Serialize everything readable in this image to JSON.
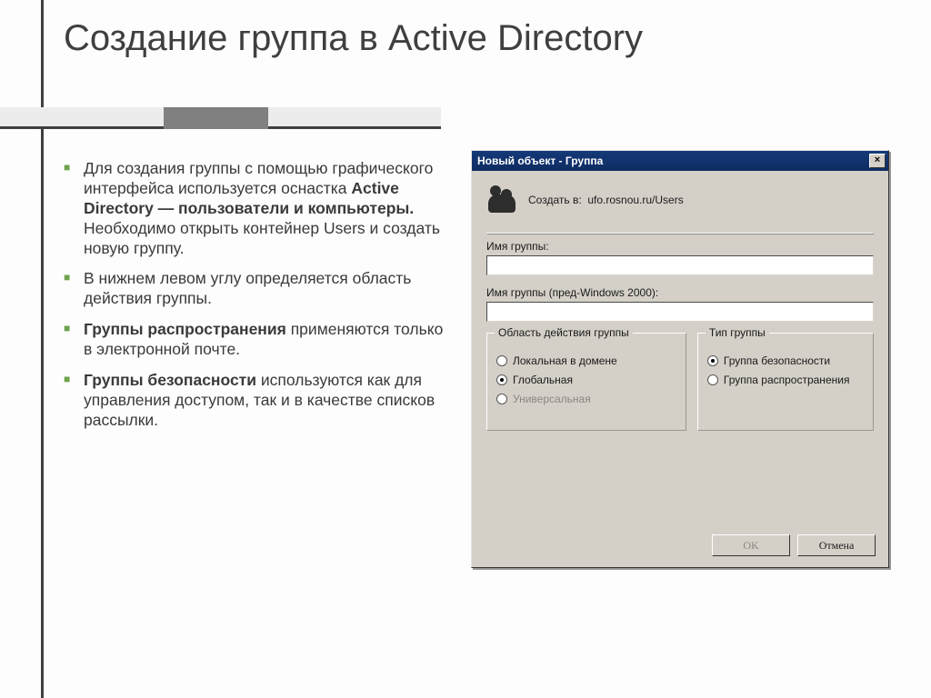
{
  "slide": {
    "title": "Создание группа в Active Directory",
    "bullets": [
      {
        "pre": "Для создания группы с помощью графического интерфейса используется оснастка ",
        "bold": "Active Directory — пользователи и компьютеры.",
        "post": " Необходимо открыть контейнер Users и создать новую группу."
      },
      {
        "text": "В нижнем левом углу определяется область действия группы."
      },
      {
        "bold_first": "Группы распространения",
        "post": " применяются только в электронной почте."
      },
      {
        "bold_first": "Группы безопасности",
        "post": " используются как для управления доступом, так и в качестве списков рассылки."
      }
    ]
  },
  "dialog": {
    "title": "Новый объект - Группа",
    "close_x": "×",
    "create_in_label": "Создать в:",
    "create_in_value": "ufo.rosnou.ru/Users",
    "field1_label": "Имя группы:",
    "field1_value": "",
    "field2_label": "Имя группы (пред-Windows 2000):",
    "field2_value": "",
    "scope": {
      "legend": "Область действия группы",
      "opts": [
        {
          "label": "Локальная в домене",
          "checked": false,
          "disabled": false
        },
        {
          "label": "Глобальная",
          "checked": true,
          "disabled": false
        },
        {
          "label": "Универсальная",
          "checked": false,
          "disabled": true
        }
      ]
    },
    "type": {
      "legend": "Тип группы",
      "opts": [
        {
          "label": "Группа безопасности",
          "checked": true
        },
        {
          "label": "Группа распространения",
          "checked": false
        }
      ]
    },
    "ok_label": "OK",
    "cancel_label": "Отмена"
  }
}
